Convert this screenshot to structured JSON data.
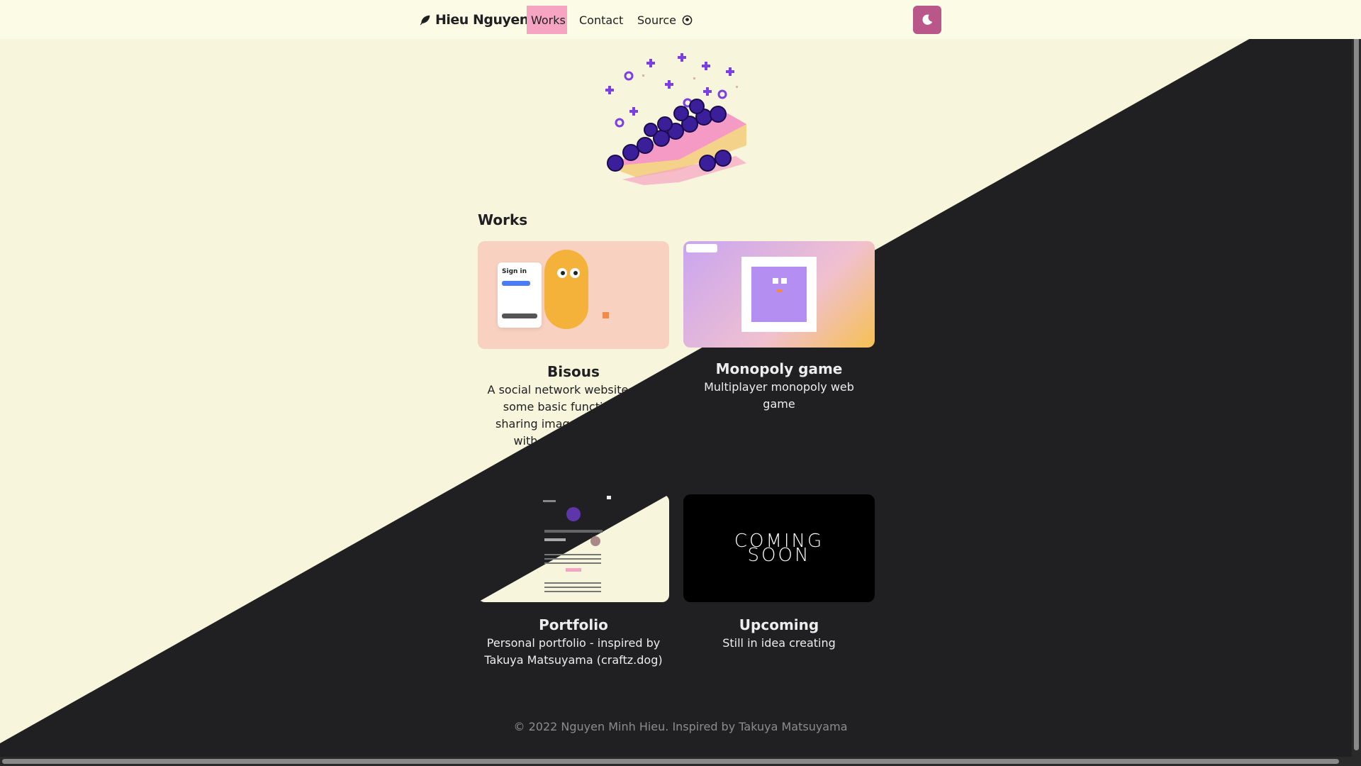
{
  "navbar": {
    "brand": "Hieu Nguyen",
    "brand_icon": "feather-icon",
    "links": [
      {
        "label": "Works",
        "active": true
      },
      {
        "label": "Contact",
        "active": false
      },
      {
        "label": "Source",
        "icon": "github-icon",
        "active": false
      }
    ],
    "theme_toggle_icon": "moon-icon"
  },
  "hero_image": "pixel-blueberry-pie",
  "section": {
    "title": "Works"
  },
  "works": [
    {
      "title": "Bisous",
      "description": "A social network website, with some basic function like: sharing images, interacting with post, messages.",
      "thumb_text": "Sign in"
    },
    {
      "title": "Monopoly game",
      "description": "Multiplayer monopoly web game"
    },
    {
      "title": "Portfolio",
      "description": "Personal portfolio - inspired by Takuya Matsuyama (craftz.dog)"
    },
    {
      "title": "Upcoming",
      "description": "Still in idea creating",
      "thumb_text_line1": "COMING",
      "thumb_text_line2": "SOON"
    }
  ],
  "footer": {
    "text": "© 2022 Nguyen Minh Hieu. Inspired by Takuya Matsuyama"
  },
  "colors": {
    "light_bg": "#f7f5db",
    "dark_bg": "#202023",
    "accent_pink": "#f7a4c3",
    "toggle_bg": "#b9568a"
  }
}
